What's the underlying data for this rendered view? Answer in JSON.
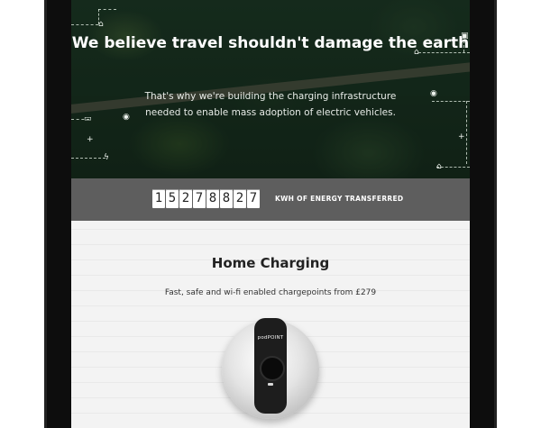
{
  "hero": {
    "title": "We believe travel shouldn't damage the earth",
    "subtitle": "That's why we're building the charging infrastructure needed to enable mass adoption of electric vehicles."
  },
  "counter": {
    "digits": [
      "1",
      "5",
      "2",
      "7",
      "8",
      "8",
      "2",
      "7"
    ],
    "label": "KWH OF ENERGY TRANSFERRED"
  },
  "home_charging": {
    "title": "Home Charging",
    "subtitle": "Fast, safe and wi-fi enabled chargepoints from £279"
  },
  "charger": {
    "brand": "podPOINT"
  },
  "colors": {
    "counter_band": "#5e5e5e",
    "hero_green": "#1a3322"
  }
}
